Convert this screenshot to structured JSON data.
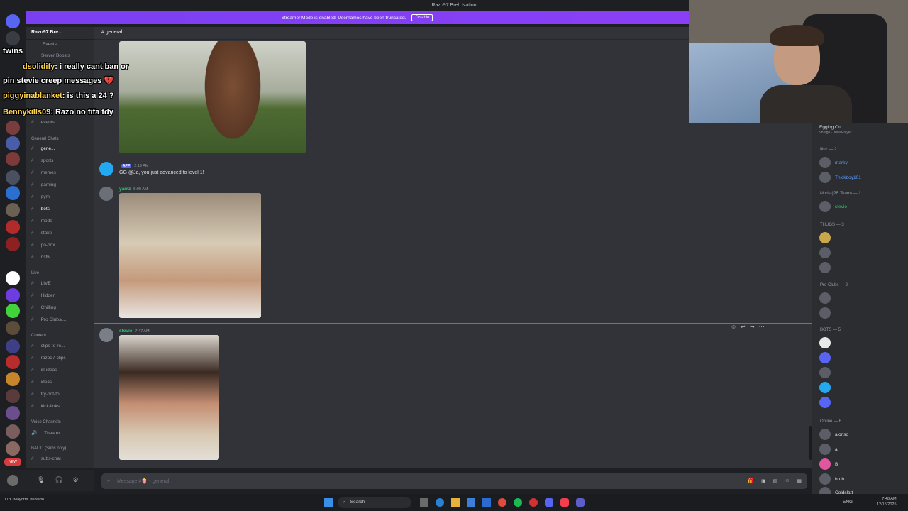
{
  "window_title": "Razo97 Breh Nation",
  "banner": {
    "text": "Streamer Mode is enabled. Usernames have been truncated.",
    "button": "Disable"
  },
  "server_name": "Razo97 Bre...",
  "channel_header": "general",
  "sidebar_top": [
    "Events",
    "Server Boosts"
  ],
  "channel_groups": [
    {
      "label": "General Chats",
      "items": [
        "events",
        "gene...",
        "sports",
        "memes",
        "gaming",
        "gym",
        "bets",
        "mods",
        "stake",
        "po-box",
        "nsfw"
      ]
    },
    {
      "label": "Live",
      "items": [
        "LIVE",
        "Hidden",
        "Chilling",
        "Pro Clubs/..."
      ]
    },
    {
      "label": "Content",
      "items": [
        "clips-to-re...",
        "razo97-clips",
        "irl-ideas",
        "ideas",
        "try-not-to...",
        "kick-links"
      ]
    },
    {
      "label": "Voice Channels",
      "items": [
        "Theater"
      ]
    },
    {
      "label": "BALID (Subs only)",
      "items": [
        "subs-chat"
      ]
    }
  ],
  "messages": [
    {
      "name": "",
      "tag": "APP",
      "time": "2:19 AM",
      "text": "GG @Ja, you just advanced to level 1!"
    },
    {
      "name": "yamz",
      "time": "5:00 AM"
    },
    {
      "name": "stevie",
      "time": "7:47 AM"
    }
  ],
  "composer_placeholder": "Message #🍿・general",
  "members": {
    "top": {
      "name": "Egging On",
      "sub": "9h ago · New Player"
    },
    "groups": [
      {
        "label": "Illuz — 2",
        "names": [
          "marky",
          "Thickboy101"
        ]
      },
      {
        "label": "Mods (PR Team) — 1",
        "names": [
          "stevie"
        ]
      },
      {
        "label": "THUGS — 3",
        "names": [
          "",
          "",
          ""
        ]
      },
      {
        "label": "Pro Clubs — 2",
        "names": [
          "",
          ""
        ]
      },
      {
        "label": "BOTS — 5",
        "names": [
          "",
          "",
          "",
          "",
          ""
        ]
      },
      {
        "label": "Online — 6",
        "names": [
          "alonso",
          "a",
          "B",
          "brob",
          "Coldslatt"
        ]
      }
    ]
  },
  "overlay_chat": [
    {
      "user": "",
      "text": "twins"
    },
    {
      "user": "dsolidify",
      "text": ": i really cant ban or"
    },
    {
      "user": "",
      "text": "pin stevie creep messages 💔"
    },
    {
      "user": "piggyinablanket",
      "text": ": is this a 24 ?"
    },
    {
      "user": "Bennykills09",
      "text": ": Razo no fifa tdy"
    }
  ],
  "taskbar": {
    "search": "Search",
    "weather": "11°C Mayorm. nublado",
    "lang": "ENG",
    "time": "7:48 AM",
    "date": "12/15/2025"
  },
  "colors": {
    "blurple": "#5865f2",
    "banner": "#8a3ff7",
    "bg": "#313338"
  }
}
